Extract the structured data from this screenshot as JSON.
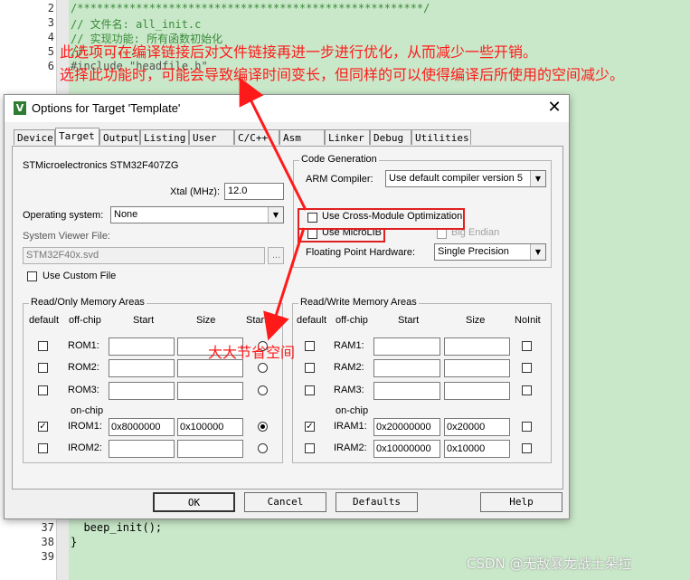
{
  "editor": {
    "lines_top": [
      {
        "num": "2",
        "code": "/*****************************************************/"
      },
      {
        "num": "3",
        "code": "// 文件名: all_init.c"
      },
      {
        "num": "4",
        "code": "// 实现功能: 所有函数初始化"
      },
      {
        "num": "5",
        "code": "//  ......"
      },
      {
        "num": "6",
        "code": "#include \"headfile.h\""
      }
    ],
    "lines_bottom": [
      {
        "num": "37",
        "code": "  beep_init();"
      },
      {
        "num": "38",
        "code": "}"
      },
      {
        "num": "39",
        "code": ""
      }
    ]
  },
  "annotations": {
    "line1": "此选项可在编译链接后对文件链接再进一步进行优化，从而减少一些开销。",
    "line2": "选择此功能时，可能会导致编译时间变长，但同样的可以使得编译后所使用的空间减少。",
    "callout": "大大节省空间"
  },
  "dialog": {
    "title": "Options for Target 'Template'",
    "close_icon": "close-icon",
    "tabs": [
      "Device",
      "Target",
      "Output",
      "Listing",
      "User",
      "C/C++",
      "Asm",
      "Linker",
      "Debug",
      "Utilities"
    ],
    "active_tab": "Target",
    "device_name": "STMicroelectronics STM32F407ZG",
    "xtal_label": "Xtal (MHz):",
    "xtal_value": "12.0",
    "os_label": "Operating system:",
    "os_value": "None",
    "svd_label": "System Viewer File:",
    "svd_value": "STM32F40x.svd",
    "browse_label": "...",
    "custom_file_label": "Use Custom File",
    "code_gen": {
      "title": "Code Generation",
      "compiler_label": "ARM Compiler:",
      "compiler_value": "Use default compiler version 5",
      "cross_module_label": "Use Cross-Module Optimization",
      "microlib_label": "Use MicroLIB",
      "big_endian_label": "Big Endian",
      "fp_label": "Floating Point Hardware:",
      "fp_value": "Single Precision"
    },
    "ro_memory": {
      "title": "Read/Only Memory Areas",
      "headers": {
        "default": "default",
        "offchip": "off-chip",
        "start": "Start",
        "size": "Size",
        "startup": "Startup"
      },
      "onchip_label": "on-chip",
      "rows": [
        {
          "name": "ROM1:",
          "start": "",
          "size": "",
          "default": false,
          "startup": false
        },
        {
          "name": "ROM2:",
          "start": "",
          "size": "",
          "default": false,
          "startup": false
        },
        {
          "name": "ROM3:",
          "start": "",
          "size": "",
          "default": false,
          "startup": false
        },
        {
          "name": "IROM1:",
          "start": "0x8000000",
          "size": "0x100000",
          "default": true,
          "startup": true
        },
        {
          "name": "IROM2:",
          "start": "",
          "size": "",
          "default": false,
          "startup": false
        }
      ]
    },
    "rw_memory": {
      "title": "Read/Write Memory Areas",
      "headers": {
        "default": "default",
        "offchip": "off-chip",
        "start": "Start",
        "size": "Size",
        "noinit": "NoInit"
      },
      "onchip_label": "on-chip",
      "rows": [
        {
          "name": "RAM1:",
          "start": "",
          "size": "",
          "default": false
        },
        {
          "name": "RAM2:",
          "start": "",
          "size": "",
          "default": false
        },
        {
          "name": "RAM3:",
          "start": "",
          "size": "",
          "default": false
        },
        {
          "name": "IRAM1:",
          "start": "0x20000000",
          "size": "0x20000",
          "default": true
        },
        {
          "name": "IRAM2:",
          "start": "0x10000000",
          "size": "0x10000",
          "default": false
        }
      ]
    },
    "buttons": {
      "ok": "OK",
      "cancel": "Cancel",
      "defaults": "Defaults",
      "help": "Help"
    }
  },
  "watermark": "CSDN @无敌暴龙战士朵拉",
  "colors": {
    "annotation": "#ff1a1a",
    "editor_bg": "#c9e8c9",
    "comment": "#3a8a3a"
  }
}
